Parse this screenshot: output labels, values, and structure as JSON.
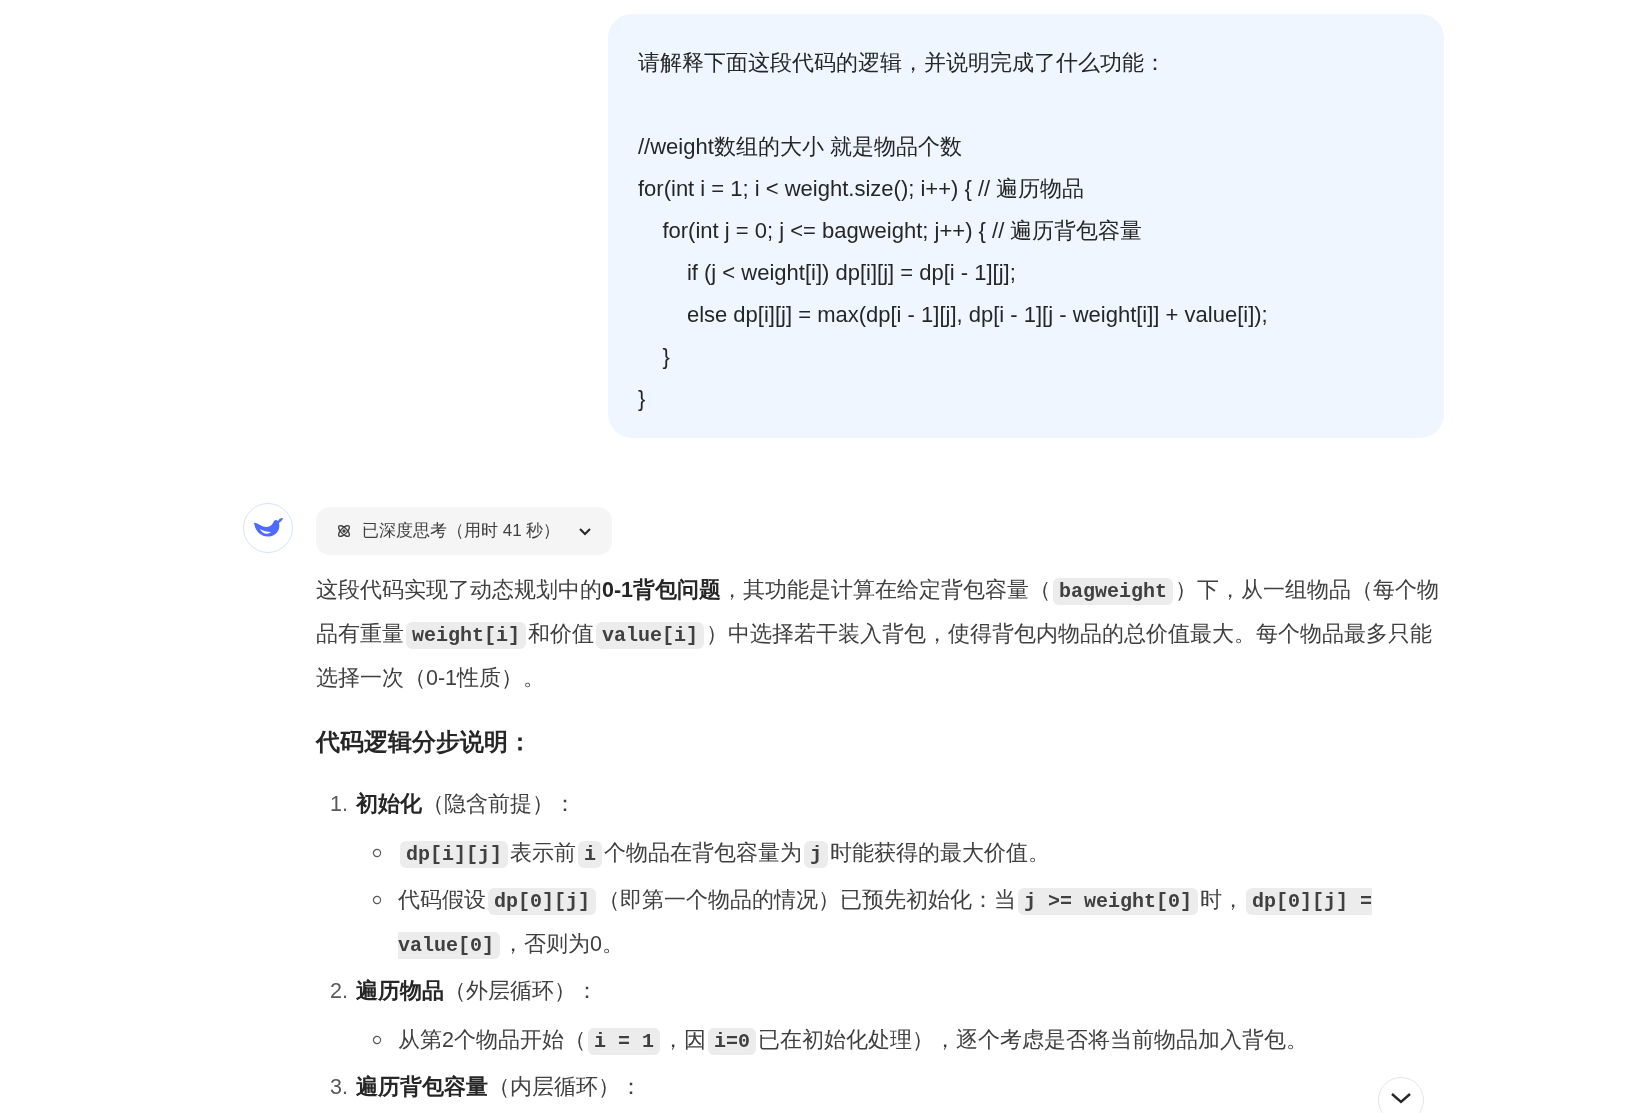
{
  "user_message": {
    "intro": "请解释下面这段代码的逻辑，并说明完成了什么功能：",
    "code_lines": [
      "//weight数组的大小 就是物品个数",
      "for(int i = 1; i < weight.size(); i++) { // 遍历物品",
      "    for(int j = 0; j <= bagweight; j++) { // 遍历背包容量",
      "        if (j < weight[i]) dp[i][j] = dp[i - 1][j];",
      "        else dp[i][j] = max(dp[i - 1][j], dp[i - 1][j - weight[i]] + value[i]);",
      "    }",
      "}"
    ]
  },
  "assistant": {
    "thinking": {
      "label": "已深度思考（用时 41 秒）",
      "expanded": false
    },
    "intro": [
      {
        "kind": "text",
        "text": "这段代码实现了动态规划中的"
      },
      {
        "kind": "bold",
        "text": "0-1背包问题"
      },
      {
        "kind": "text",
        "text": "，其功能是计算在给定背包容量（"
      },
      {
        "kind": "code",
        "text": "bagweight"
      },
      {
        "kind": "text",
        "text": "）下，从一组物品（每个物品有重量"
      },
      {
        "kind": "code",
        "text": "weight[i]"
      },
      {
        "kind": "text",
        "text": "和价值"
      },
      {
        "kind": "code",
        "text": "value[i]"
      },
      {
        "kind": "text",
        "text": "）中选择若干装入背包，使得背包内物品的总价值最大。每个物品最多只能选择一次（0-1性质）。"
      }
    ],
    "heading": "代码逻辑分步说明：",
    "steps": [
      {
        "number": "1.",
        "title": "初始化",
        "note": "（隐含前提）：",
        "bullets": [
          [
            {
              "kind": "code",
              "text": "dp[i][j]"
            },
            {
              "kind": "text",
              "text": "表示前"
            },
            {
              "kind": "code",
              "text": "i"
            },
            {
              "kind": "text",
              "text": "个物品在背包容量为"
            },
            {
              "kind": "code",
              "text": "j"
            },
            {
              "kind": "text",
              "text": "时能获得的最大价值。"
            }
          ],
          [
            {
              "kind": "text",
              "text": "代码假设"
            },
            {
              "kind": "code",
              "text": "dp[0][j]"
            },
            {
              "kind": "text",
              "text": "（即第一个物品的情况）已预先初始化：当"
            },
            {
              "kind": "code",
              "text": "j >= weight[0]"
            },
            {
              "kind": "text",
              "text": "时，"
            },
            {
              "kind": "code",
              "text": "dp[0][j] = value[0]"
            },
            {
              "kind": "text",
              "text": "，否则为0。"
            }
          ]
        ]
      },
      {
        "number": "2.",
        "title": "遍历物品",
        "note": "（外层循环）：",
        "bullets": [
          [
            {
              "kind": "text",
              "text": "从第2个物品开始（"
            },
            {
              "kind": "code",
              "text": "i = 1"
            },
            {
              "kind": "text",
              "text": "，因"
            },
            {
              "kind": "code",
              "text": "i=0"
            },
            {
              "kind": "text",
              "text": "已在初始化处理），逐个考虑是否将当前物品加入背包。"
            }
          ]
        ]
      },
      {
        "number": "3.",
        "title": "遍历背包容量",
        "note": "（内层循环）："
      }
    ]
  }
}
